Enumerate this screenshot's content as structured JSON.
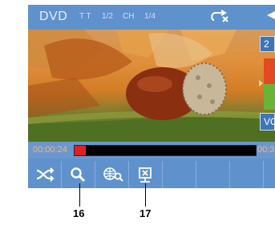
{
  "header": {
    "source": "DVD",
    "title_label": "T T",
    "title_value": "1/2",
    "chapter_label": "CH",
    "chapter_value": "1/4"
  },
  "side": {
    "number": "2",
    "vo_label": "VO"
  },
  "playback": {
    "elapsed": "00:00:24",
    "total": "00:3",
    "progress": 0.06
  },
  "toolbar": {
    "buttons": [
      {
        "icon": "shuffle-icon"
      },
      {
        "icon": "search-icon"
      },
      {
        "icon": "zoom-icon"
      },
      {
        "icon": "subtitle-icon"
      }
    ]
  },
  "callouts": {
    "search": "16",
    "subtitle": "17"
  },
  "colors": {
    "screen": "#5f92cc",
    "progress_fill": "#e02020",
    "time_text": "#ffb07a"
  }
}
